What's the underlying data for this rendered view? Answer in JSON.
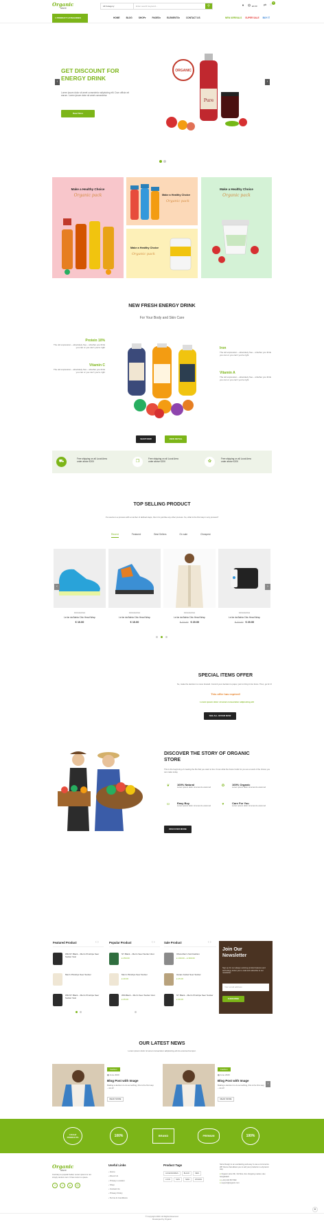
{
  "header": {
    "logo_line1": "Organic",
    "logo_line2": "store",
    "category_select": "All Category",
    "search_placeholder": "Enter search keyword...",
    "cart_total": "£0.00",
    "cart_count": "0",
    "categories_button": "PRODUCT CATEGORIES",
    "nav": [
      "HOME",
      "BLOG",
      "SHOP",
      "PAGES",
      "ELEMENTS",
      "CONTACT US"
    ],
    "links": [
      "NEW ARRIVALS",
      "SUPER SALE",
      "BUY IT"
    ]
  },
  "hero": {
    "title_line1": "GET DISCOUNT FOR",
    "title_line2": "ENERGY DRINK",
    "text_line1": "Lorem ipsum dolor sit amet consectetur adipisicing elit. Dum officia vel",
    "text_line2": "earum. Lorem ipsum dolor sit amet consectetur.",
    "button": "Read More",
    "badge": "ORGANIC",
    "bottle_label": "Pure"
  },
  "promo": {
    "card1_title": "Make a Healthy Choice",
    "card1_sub": "Organic pack",
    "card2_title": "Make a Healthy Choice",
    "card2_sub": "Organic pack",
    "card3_title": "Make a Healthy Choice",
    "card3_sub": "Organic pack",
    "card4_title": "Make a Healthy Choice",
    "card4_sub": "Organic pack"
  },
  "drink": {
    "title": "NEW FRESH ENERGY DRINK",
    "subtitle": "For Your Body and Skin Care",
    "features": [
      {
        "name": "Protein 10%",
        "text": "The old expression – absolutely free – whether you think you can or you can't you're right"
      },
      {
        "name": "Vitamin C",
        "text": "The old expression – absolutely free – whether you think you can or you can't you're right"
      },
      {
        "name": "Iron",
        "text": "The old expression – absolutely free – whether you think you can or you can't you're right"
      },
      {
        "name": "Vitamin A",
        "text": "The old expression – absolutely free – whether you think you can or you can't you're right"
      }
    ],
    "shop_button": "SHOP NOW",
    "view_button": "VIEW DETAIL"
  },
  "shipping": [
    {
      "line1": "Free shipping on all Local Area",
      "line2": "order above £200"
    },
    {
      "line1": "Free shipping on all Local Area",
      "line2": "order above £200"
    },
    {
      "line1": "Free shipping on all Local Area",
      "line2": "order above £200"
    }
  ],
  "top_selling": {
    "title": "TOP SELLING PRODUCT",
    "subtitle": "If a source is a process with a number of defined steps, then it is just like any other process. So, what is the first step in any process?",
    "tabs": [
      "Recent",
      "Featured",
      "Best Sellers",
      "On sale",
      "Cheapest"
    ],
    "products": [
      {
        "category": "Accessories",
        "name": "Le far da Bahia Chic Head Wrap",
        "old_price": "",
        "price": "€ 10.00"
      },
      {
        "category": "Accessories",
        "name": "Le far da Bahia Chic Head Wrap",
        "old_price": "",
        "price": "€ 10.00"
      },
      {
        "category": "Accessories",
        "name": "Le far da Bahia Chic Head Wrap",
        "old_price": "€ 22.00",
        "price": "€ 20.00"
      },
      {
        "category": "Accessories",
        "name": "Le far da Bahia Chic Head Wrap",
        "old_price": "€ 22.00",
        "price": "€ 20.00"
      }
    ]
  },
  "special": {
    "title": "SPECIAL ITEMS OFFER",
    "text": "So, make the decision to move forward. Commit your decision to paper, just to bring it into focus. Then, go for it!",
    "expired": "This offer has expired!",
    "tagline": "Lorem ipsum dolor sit amet consectetur adipisicing elit",
    "button": "SEE ALL OFFER NOW"
  },
  "story": {
    "title_line1": "DISCOVER THE STORY OF ORGANIC",
    "title_line2": "STORE",
    "text": "This is the beginning of creating the life that you want to live. Know what the future holds for you as a result of the choice you can make today.",
    "features": [
      {
        "name": "100% Natural",
        "text": "Lorem ipsum dolor sit amet do eiusmod"
      },
      {
        "name": "100% Organic",
        "text": "Lorem ipsum dolor sit amet do eiusmod"
      },
      {
        "name": "Easy Buy",
        "text": "Lorem ipsum dolor sit amet do eiusmod"
      },
      {
        "name": "Care For You",
        "text": "Lorem ipsum dolor sit amet do eiusmod"
      }
    ],
    "button": "DISCOVER MORE"
  },
  "lists": {
    "columns": [
      {
        "title": "Featured Product",
        "items": [
          {
            "name": "WD-NY Black – Men's Pinstripe Seer Sucker Vest",
            "price": ""
          },
          {
            "name": "Men's Pinstripe Seer Sucker",
            "price": ""
          },
          {
            "name": "WD-NY Black – Men's Pinstripe Seer Sucker Vest",
            "price": ""
          }
        ]
      },
      {
        "title": "Popular Product",
        "items": [
          {
            "name": "NY Black – Men's Seer Sucker Vest",
            "price": "£ 250.00"
          },
          {
            "name": "Men's Pinstripe Seer Sucker",
            "price": "£ 20.00"
          },
          {
            "name": "WD-Black – Men's Seer Sucker Vest",
            "price": "£ 25.00"
          }
        ]
      },
      {
        "title": "Sale Product",
        "items": [
          {
            "name": "Olivia Men's Suit Fashion",
            "price": "£ 199.00 – £ 399.00"
          },
          {
            "name": "Hanan Jacket Seer Sucker",
            "price": "£ 25.00"
          },
          {
            "name": "NY Black – Men's Pinstripe Seer Sucker",
            "price": "£ 30.00"
          }
        ]
      }
    ],
    "newsletter": {
      "title_line1": "Join Our",
      "title_line2": "Newsletter",
      "text": "Sign up for our always evolving product features and technology. Enter your e-mail and subscribe to our newsletter.",
      "placeholder": "Your email address",
      "button": "SUBSCRIBE"
    }
  },
  "news": {
    "title": "OUR LATEST NEWS",
    "subtitle": "Lorem ipsum dolor sit amet consectetur adipisicing elit do eiusmod tempor.",
    "posts": [
      {
        "tag": "Fashion",
        "date": "June 2020",
        "title": "Blog Post with Image",
        "excerpt": "Making a decision to do something, this is the first step – we all",
        "button": "READ MORE"
      },
      {
        "tag": "Fashion",
        "date": "June 2020",
        "title": "Blog Post with Image",
        "excerpt": "Making a decision to do something, this is the first step – we all",
        "button": "READ MORE"
      }
    ]
  },
  "brands": [
    "Lifeleaf PRODUCTS",
    "100%",
    "BRAND",
    "PREMIUM",
    "100%"
  ],
  "footer": {
    "about": "Contrary to popular belief, Lorem Ipsum is not simply random text. It has roots in a piece.",
    "useful_title": "Useful Links",
    "useful_links": [
      "Home",
      "About Us",
      "Privacy Location",
      "Shop",
      "Contact Us",
      "Privacy Policy",
      "Terms & Conditions"
    ],
    "tags_title": "Product Tags",
    "tags": [
      "ACCESSORIES",
      "BLACK",
      "MEN",
      "LOOK",
      "MAN",
      "NEW",
      "WOMAN"
    ],
    "contact_text": "Store Design is an everlasting and easy to use e-Commerce WP theme that allows you to sell your products in a dynamic way.",
    "contact": [
      "Organic store 6th, 3rd floor, dev shopping market, dev, bangladesh",
      "(+01) 234 567 890",
      "support@organic.com"
    ],
    "copyright": "© Copyright 2020. All Rights Reserved.",
    "developer": "Developed by Organic"
  },
  "colors": {
    "accent": "#7cb518",
    "dark": "#222222",
    "brand_bar": "#7cb518",
    "newsletter": "#4a3322"
  }
}
